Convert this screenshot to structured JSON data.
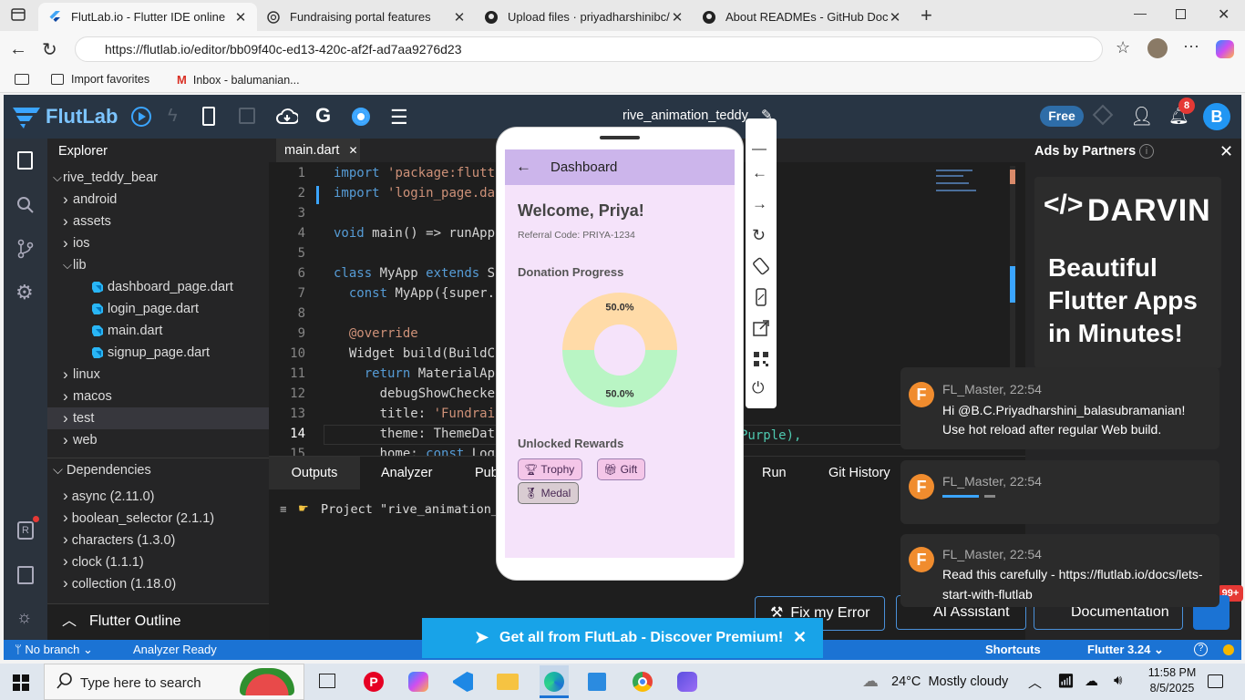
{
  "browser": {
    "tabs": [
      {
        "title": "FlutLab.io - Flutter IDE online",
        "icon": "flutter-icon"
      },
      {
        "title": "Fundraising portal features",
        "icon": "chatgpt-icon"
      },
      {
        "title": "Upload files · priyadharshinibc/fur",
        "icon": "github-icon"
      },
      {
        "title": "About READMEs - GitHub Docs",
        "icon": "github-icon"
      }
    ],
    "url": "https://flutlab.io/editor/bb09f40c-ed13-420c-af2f-ad7aa9276d23",
    "favorites": [
      {
        "label": "Import favorites"
      },
      {
        "label": "Inbox - balumanian..."
      }
    ]
  },
  "topbar": {
    "brand": "FlutLab",
    "project_name": "rive_animation_teddy",
    "plan_badge": "Free",
    "notif_count": "8",
    "user_initial": "B"
  },
  "explorer": {
    "title": "Explorer",
    "tree": [
      {
        "label": "rive_teddy_bear",
        "level": 0,
        "kind": "folder-open"
      },
      {
        "label": "android",
        "level": 1,
        "kind": "folder"
      },
      {
        "label": "assets",
        "level": 1,
        "kind": "folder"
      },
      {
        "label": "ios",
        "level": 1,
        "kind": "folder"
      },
      {
        "label": "lib",
        "level": 1,
        "kind": "folder-open"
      },
      {
        "label": "dashboard_page.dart",
        "level": 2,
        "kind": "file"
      },
      {
        "label": "login_page.dart",
        "level": 2,
        "kind": "file"
      },
      {
        "label": "main.dart",
        "level": 2,
        "kind": "file"
      },
      {
        "label": "signup_page.dart",
        "level": 2,
        "kind": "file"
      },
      {
        "label": "linux",
        "level": 1,
        "kind": "folder"
      },
      {
        "label": "macos",
        "level": 1,
        "kind": "folder"
      },
      {
        "label": "test",
        "level": 1,
        "kind": "folder",
        "selected": true
      },
      {
        "label": "web",
        "level": 1,
        "kind": "folder"
      }
    ],
    "dependencies_title": "Dependencies",
    "dependencies": [
      "async (2.11.0)",
      "boolean_selector (2.1.1)",
      "characters (1.3.0)",
      "clock (1.1.1)",
      "collection (1.18.0)"
    ],
    "outline_title": "Flutter Outline"
  },
  "editor": {
    "tab_name": "main.dart",
    "lines": [
      {
        "n": "1",
        "code": "import 'package:flutt"
      },
      {
        "n": "2",
        "code": "import 'login_page.da"
      },
      {
        "n": "3",
        "code": ""
      },
      {
        "n": "4",
        "code": "void main() => runApp"
      },
      {
        "n": "5",
        "code": ""
      },
      {
        "n": "6",
        "code": "class MyApp extends S"
      },
      {
        "n": "7",
        "code": "  const MyApp({super."
      },
      {
        "n": "8",
        "code": ""
      },
      {
        "n": "9",
        "code": "  @override"
      },
      {
        "n": "10",
        "code": "  Widget build(BuildC"
      },
      {
        "n": "11",
        "code": "    return MaterialAp"
      },
      {
        "n": "12",
        "code": "      debugShowChecke"
      },
      {
        "n": "13",
        "code": "      title: 'Fundrai"
      },
      {
        "n": "14",
        "code": "      theme: ThemeDat"
      },
      {
        "n": "15",
        "code": "      home: const Log"
      }
    ],
    "line14_tail": "Purple),"
  },
  "bottom": {
    "tabs": [
      "Outputs",
      "Analyzer",
      "Pub",
      "Run",
      "Git History"
    ],
    "output_line": "Project \"rive_animation_t"
  },
  "ads": {
    "title": "Ads by Partners",
    "brand": "DARVIN",
    "headline": "Beautiful Flutter Apps in Minutes!"
  },
  "phone": {
    "appbar_title": "Dashboard",
    "welcome": "Welcome, Priya!",
    "referral": "Referral Code: PRIYA-1234",
    "progress_title": "Donation Progress",
    "rewards_title": "Unlocked Rewards",
    "rewards": [
      {
        "label": "Trophy",
        "icon": "trophy-icon"
      },
      {
        "label": "Gift",
        "icon": "gift-icon"
      },
      {
        "label": "Medal",
        "icon": "medal-icon"
      }
    ]
  },
  "chart_data": {
    "type": "pie",
    "categories": [
      "",
      ""
    ],
    "values": [
      50.0,
      50.0
    ],
    "labels": [
      "50.0%",
      "50.0%"
    ],
    "colors": [
      "#ffdba8",
      "#b9f5c4"
    ],
    "donut": true
  },
  "chat": [
    {
      "author": "FL_Master, 22:54",
      "text": "Hi @B.C.Priyadharshini_balasubramanian! Use hot reload after regular Web build."
    },
    {
      "author": "FL_Master, 22:54",
      "text": ""
    },
    {
      "author": "FL_Master, 22:54",
      "text": "Read this carefully - https://flutlab.io/docs/lets-start-with-flutlab"
    }
  ],
  "chat_unread": "99+",
  "buttons": {
    "fix_error": "Fix my Error",
    "ai_assistant": "AI Assistant",
    "documentation": "Documentation"
  },
  "banner": {
    "text": "Get all from FlutLab - Discover Premium!"
  },
  "statusbar": {
    "branch": "No branch",
    "analyzer": "Analyzer Ready",
    "shortcuts": "Shortcuts",
    "flutter_version": "Flutter 3.24"
  },
  "taskbar": {
    "search_placeholder": "Type here to search",
    "weather": "24°C  Mostly cloudy",
    "time": "11:58 PM",
    "date": "8/5/2025"
  }
}
